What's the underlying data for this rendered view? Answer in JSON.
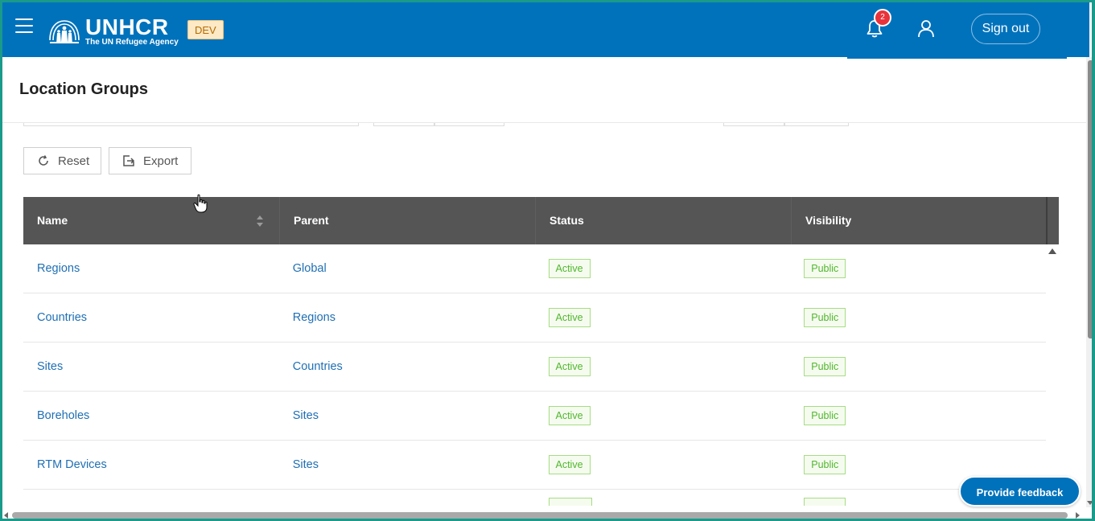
{
  "header": {
    "logo": {
      "main": "UNHCR",
      "sub": "The UN Refugee Agency"
    },
    "env_badge": "DEV",
    "notifications_count": "2",
    "signout_label": "Sign out",
    "brand_color": "#0072bc"
  },
  "page": {
    "title": "Location Groups"
  },
  "actions": {
    "reset_label": "Reset",
    "export_label": "Export"
  },
  "table": {
    "columns": [
      "Name",
      "Parent",
      "Status",
      "Visibility"
    ],
    "rows": [
      {
        "name": "Regions",
        "parent": "Global",
        "status": "Active",
        "visibility": "Public"
      },
      {
        "name": "Countries",
        "parent": "Regions",
        "status": "Active",
        "visibility": "Public"
      },
      {
        "name": "Sites",
        "parent": "Countries",
        "status": "Active",
        "visibility": "Public"
      },
      {
        "name": "Boreholes",
        "parent": "Sites",
        "status": "Active",
        "visibility": "Public"
      },
      {
        "name": "RTM Devices",
        "parent": "Sites",
        "status": "Active",
        "visibility": "Public"
      }
    ]
  },
  "feedback_label": "Provide feedback",
  "icons": {
    "menu": "hamburger-icon",
    "bell": "bell-icon",
    "user": "user-icon",
    "reset": "refresh-icon",
    "export": "export-icon",
    "sort": "sort-icon"
  },
  "colors": {
    "status_green": "#52b52e",
    "link": "#1f6fb4",
    "table_header": "#555555"
  }
}
